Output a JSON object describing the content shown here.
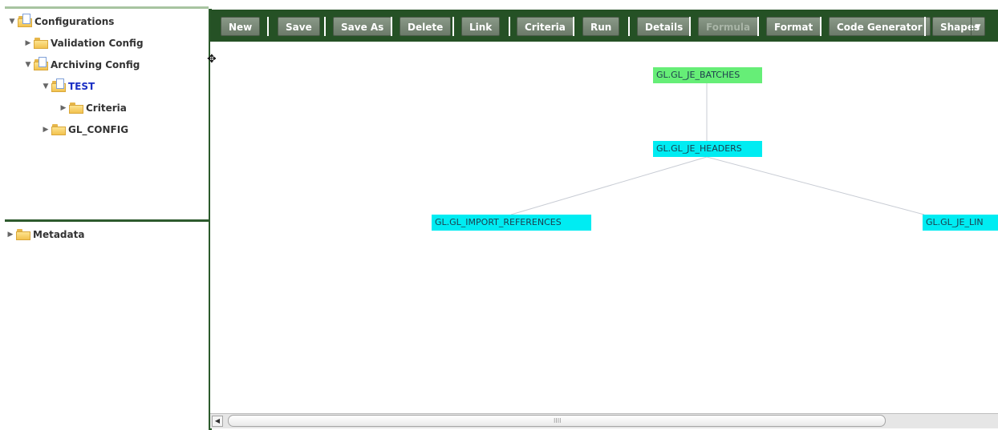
{
  "sidebar": {
    "top_tree": [
      {
        "label": "Configurations",
        "expanded": true,
        "icon": "document-folder-icon"
      },
      {
        "label": "Validation Config",
        "expanded": false,
        "icon": "folder-icon"
      },
      {
        "label": "Archiving Config",
        "expanded": true,
        "icon": "document-folder-icon"
      },
      {
        "label": "TEST",
        "expanded": true,
        "icon": "document-folder-icon",
        "selected": true
      },
      {
        "label": "Criteria",
        "expanded": false,
        "icon": "folder-icon"
      },
      {
        "label": "GL_CONFIG",
        "expanded": false,
        "icon": "folder-icon"
      }
    ],
    "bottom_tree": [
      {
        "label": "Metadata",
        "expanded": false,
        "icon": "folder-icon"
      }
    ]
  },
  "toolbar": {
    "buttons": [
      "New",
      "Save",
      "Save As",
      "Delete",
      "Link",
      "Criteria",
      "Run",
      "Details",
      "Formula",
      "Format",
      "Code Generator",
      "Shapes"
    ],
    "disabled": [
      "Formula"
    ],
    "colors": {
      "background": "#255125",
      "button": "#7a8978"
    }
  },
  "diagram": {
    "nodes": [
      {
        "id": "batches",
        "label": "GL.GL_JE_BATCHES",
        "color": "#66ee77"
      },
      {
        "id": "headers",
        "label": "GL.GL_JE_HEADERS",
        "color": "#00ecf2"
      },
      {
        "id": "import",
        "label": "GL.GL_IMPORT_REFERENCES",
        "color": "#00ecf2"
      },
      {
        "id": "lines",
        "label": "GL.GL_JE_LIN",
        "color": "#00ecf2"
      }
    ],
    "edges": [
      {
        "from": "batches",
        "to": "headers"
      },
      {
        "from": "headers",
        "to": "import"
      },
      {
        "from": "headers",
        "to": "lines"
      }
    ]
  },
  "scrollbar": {
    "grip": "IIII"
  }
}
